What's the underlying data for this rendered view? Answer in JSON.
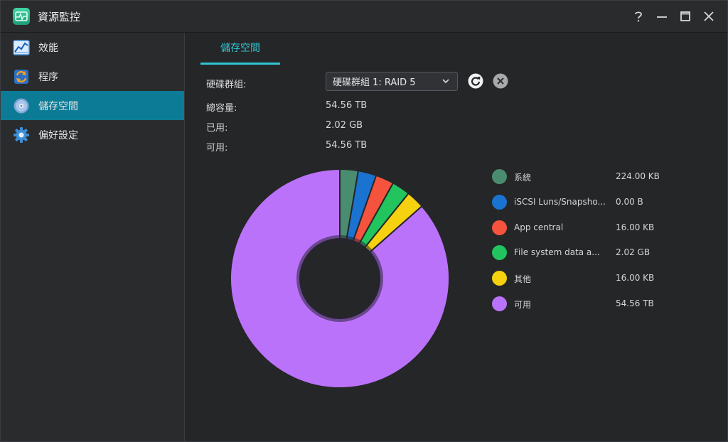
{
  "window": {
    "title": "資源監控",
    "controls": [
      "help-icon",
      "minimize-icon",
      "maximize-icon",
      "close-icon"
    ]
  },
  "sidebar": {
    "items": [
      {
        "label": "效能",
        "icon": "performance-chart-icon",
        "active": false
      },
      {
        "label": "程序",
        "icon": "process-icon",
        "active": false
      },
      {
        "label": "儲存空間",
        "icon": "storage-disk-icon",
        "active": true
      },
      {
        "label": "偏好設定",
        "icon": "gear-icon",
        "active": false
      }
    ]
  },
  "tabs": [
    {
      "label": "儲存空間",
      "active": true
    }
  ],
  "storage": {
    "group_label": "硬碟群組:",
    "group_selected": "硬碟群組 1: RAID 5",
    "total_label": "總容量:",
    "total_value": "54.56 TB",
    "used_label": "已用:",
    "used_value": "2.02 GB",
    "available_label": "可用:",
    "available_value": "54.56 TB"
  },
  "legend": [
    {
      "name": "系統",
      "size": "224.00 KB",
      "color": "#4a8c6f"
    },
    {
      "name": "iSCSI Luns/Snapsho...",
      "size": "0.00 B",
      "color": "#1a73d1"
    },
    {
      "name": "App central",
      "size": "16.00 KB",
      "color": "#f5533d"
    },
    {
      "name": "File system data a...",
      "size": "2.02 GB",
      "color": "#22c45e"
    },
    {
      "name": "其他",
      "size": "16.00 KB",
      "color": "#f5d10f"
    },
    {
      "name": "可用",
      "size": "54.56 TB",
      "color": "#bb72fa"
    }
  ],
  "chart_data": {
    "type": "pie",
    "style": "donut",
    "labels": [
      "系統",
      "iSCSI Luns/Snapsho...",
      "App central",
      "File system data a...",
      "其他",
      "可用"
    ],
    "sizes": [
      "224.00 KB",
      "0.00 B",
      "16.00 KB",
      "2.02 GB",
      "16.00 KB",
      "54.56 TB"
    ],
    "display_share_percent": [
      2.7,
      2.7,
      2.7,
      2.7,
      2.7,
      86.5
    ],
    "colors": [
      "#4a8c6f",
      "#1a73d1",
      "#f5533d",
      "#22c45e",
      "#f5d10f",
      "#bb72fa"
    ]
  }
}
